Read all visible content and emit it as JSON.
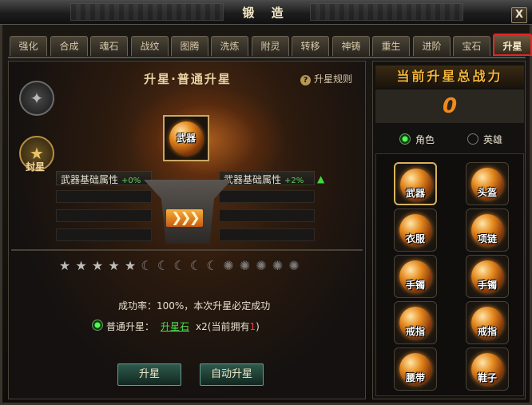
{
  "window": {
    "title": "锻 造",
    "close_label": "X"
  },
  "tabs": [
    {
      "label": "强化"
    },
    {
      "label": "合成"
    },
    {
      "label": "魂石"
    },
    {
      "label": "战纹"
    },
    {
      "label": "图腾"
    },
    {
      "label": "洗炼"
    },
    {
      "label": "附灵"
    },
    {
      "label": "转移"
    },
    {
      "label": "神铸"
    },
    {
      "label": "重生"
    },
    {
      "label": "进阶"
    },
    {
      "label": "宝石"
    },
    {
      "label": "升星",
      "active": true
    }
  ],
  "left": {
    "title": "升星·普通升星",
    "rules_label": "升星规则",
    "medal_label": "封星",
    "center_item": "武器",
    "attr_left": {
      "label": "武器基础属性",
      "pct": "+0%"
    },
    "attr_right": {
      "label": "武器基础属性",
      "pct": "+2%"
    },
    "stars": [
      "star",
      "star",
      "star",
      "star",
      "star",
      "moon",
      "moon",
      "moon",
      "moon",
      "moon",
      "sun",
      "sun",
      "sun",
      "sun",
      "sun"
    ],
    "success_rate": "成功率：100%，本次升星必定成功",
    "upgrade": {
      "label": "普通升星：",
      "item": "升星石",
      "qty_prefix": "x2(当前拥有",
      "count": "1",
      "qty_suffix": ")"
    },
    "buttons": {
      "upgrade": "升星",
      "auto_upgrade": "自动升星"
    }
  },
  "right": {
    "title": "当前升星总战力",
    "power": "0",
    "toggle": {
      "role": "角色",
      "hero": "英雄",
      "selected": "role"
    },
    "slots": [
      "武器",
      "头盔",
      "衣服",
      "项链",
      "手镯",
      "手镯",
      "戒指",
      "戒指",
      "腰带",
      "鞋子"
    ]
  },
  "colors": {
    "active_tab_border": "#e12727",
    "accent": "#f5b73a",
    "green": "#4ee04e"
  }
}
